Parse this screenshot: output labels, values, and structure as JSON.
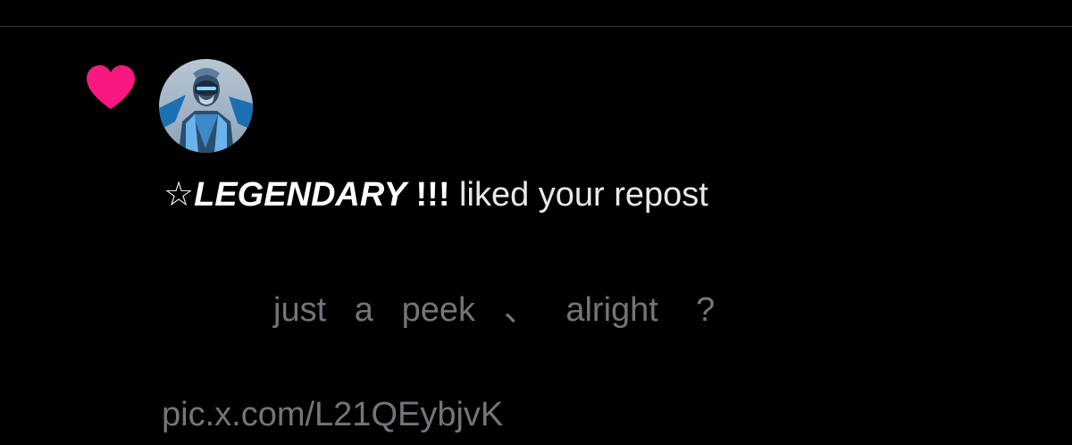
{
  "notification": {
    "type_icon": "heart-icon",
    "accent_color": "#f91880",
    "avatar_icon": "avatar",
    "user_name": "☆LEGENDARY !!!",
    "user_name_parts": {
      "star": "☆",
      "word": "LEGENDARY",
      "suffix": " !!!"
    },
    "action_text": " liked your repost",
    "post_text": "just   a   peek   、   alright    ?",
    "post_link": "pic.x.com/L21QEybjvK"
  },
  "colors": {
    "background": "#000000",
    "primary_text": "#e7e9ea",
    "secondary_text": "#71767b",
    "divider": "#2f3336"
  }
}
